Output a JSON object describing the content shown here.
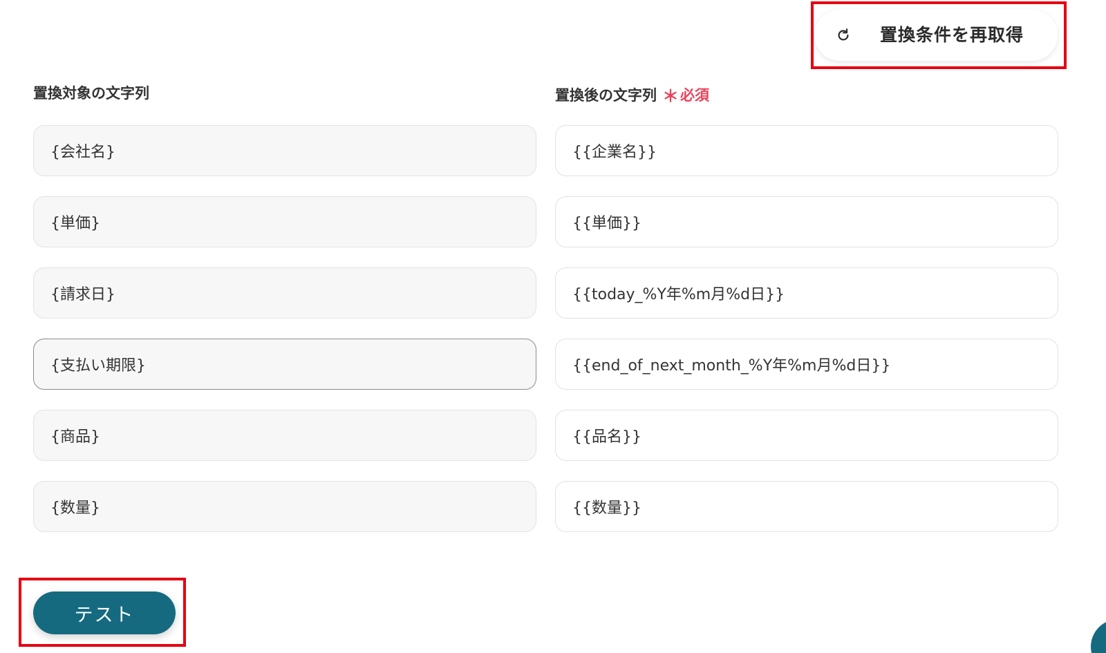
{
  "header": {
    "refresh_button_label": "置換条件を再取得",
    "refresh_icon": "refresh-icon"
  },
  "columns": {
    "source_label": "置換対象の文字列",
    "target_label": "置換後の文字列",
    "required_star": "＊",
    "required_text": "必須"
  },
  "rows": [
    {
      "source": "{会社名}",
      "target": "{{企業名}}"
    },
    {
      "source": "{単価}",
      "target": "{{単価}}"
    },
    {
      "source": "{請求日}",
      "target": "{{today_%Y年%m月%d日}}"
    },
    {
      "source": "{支払い期限}",
      "target": "{{end_of_next_month_%Y年%m月%d日}}"
    },
    {
      "source": "{商品}",
      "target": "{{品名}}"
    },
    {
      "source": "{数量}",
      "target": "{{数量}}"
    }
  ],
  "footer": {
    "test_button_label": "テスト"
  },
  "colors": {
    "accent": "#156a80",
    "highlight": "#e60012",
    "required": "#e8435a"
  }
}
